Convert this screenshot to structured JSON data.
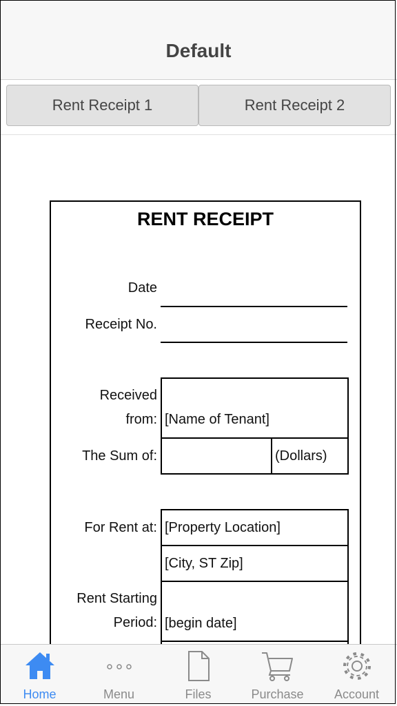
{
  "header": {
    "title": "Default"
  },
  "segments": [
    {
      "label": "Rent Receipt 1"
    },
    {
      "label": "Rent Receipt 2"
    }
  ],
  "receipt": {
    "title": "RENT RECEIPT",
    "date_label": "Date",
    "receipt_no_label": "Receipt No.",
    "received_label_line1": "Received",
    "received_label_line2": "from:",
    "received_value": "[Name of Tenant]",
    "sum_label": "The Sum of:",
    "sum_unit": "(Dollars)",
    "rent_at_label": "For Rent at:",
    "property_value": "[Property Location]",
    "city_value": "[City, ST  Zip]",
    "period_label_line1": "Rent Starting",
    "period_label_line2": "Period:",
    "period_value": "[begin date]"
  },
  "tabbar": {
    "items": [
      {
        "label": "Home",
        "icon": "home-icon",
        "active": true
      },
      {
        "label": "Menu",
        "icon": "more-icon",
        "active": false
      },
      {
        "label": "Files",
        "icon": "file-icon",
        "active": false
      },
      {
        "label": "Purchase",
        "icon": "cart-icon",
        "active": false
      },
      {
        "label": "Account",
        "icon": "gear-icon",
        "active": false
      }
    ],
    "active_color": "#3d8bf2",
    "inactive_color": "#8a8a8a"
  }
}
